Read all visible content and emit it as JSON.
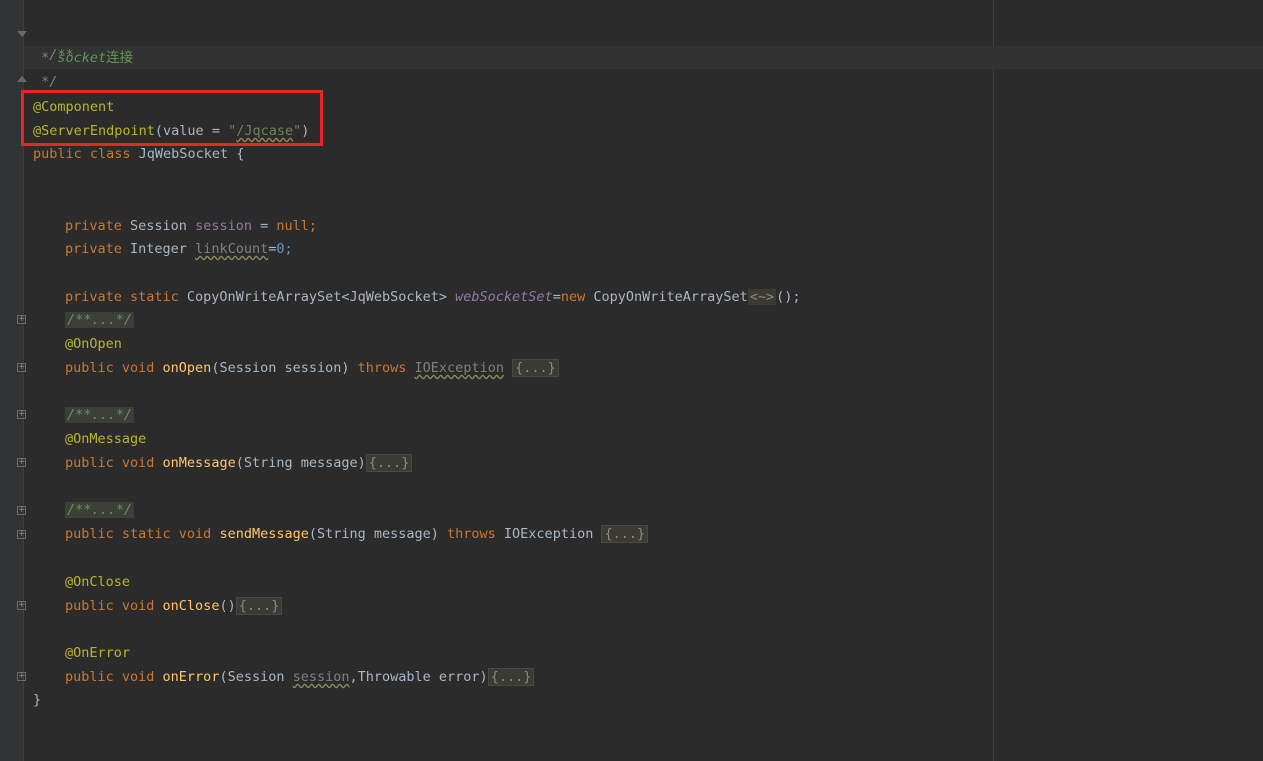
{
  "editor": {
    "lines": {
      "doc_open": "/**",
      "doc_body_star": " * ",
      "doc_body_word": "socket",
      "doc_body_cn": "连接",
      "doc_close": " */",
      "ann_component": "@Component",
      "ann_server": "@ServerEndpoint",
      "server_args_open": "(value = ",
      "server_str_q1": "\"",
      "server_str_path": "/Jqcase",
      "server_str_q2": "\"",
      "server_args_close": ")",
      "class_kw": "public class ",
      "class_name": "JqWebSocket {",
      "f1_kw": "private ",
      "f1_type": "Session ",
      "f1_name": "session",
      "f1_eq": " = ",
      "f1_val": "null;",
      "f2_kw": "private ",
      "f2_type": "Integer ",
      "f2_name": "linkCount",
      "f2_eq": "=",
      "f2_val": "0;",
      "f3_kw": "private static ",
      "f3_type": "CopyOnWriteArraySet<JqWebSocket> ",
      "f3_name": "webSocketSet",
      "f3_eq": "=",
      "f3_new": "new ",
      "f3_ctor": "CopyOnWriteArraySet",
      "f3_diamond": "<~>",
      "f3_end": "();",
      "fold_doc": "/**...*/",
      "ann_onopen": "@OnOpen",
      "m1_kw": "public void ",
      "m1_name": "onOpen",
      "m1_params": "(Session session) ",
      "m1_throws": "throws ",
      "m1_ex": "IOException",
      "fold_body": "{...}",
      "ann_onmessage": "@OnMessage",
      "m2_kw": "public void ",
      "m2_name": "onMessage",
      "m2_params": "(String message)",
      "m3_kw": "public static void ",
      "m3_name": "sendMessage",
      "m3_params": "(String message) ",
      "m3_throws": "throws ",
      "m3_ex": "IOException ",
      "ann_onclose": "@OnClose",
      "m4_kw": "public void ",
      "m4_name": "onClose",
      "m4_params": "()",
      "ann_onerror": "@OnError",
      "m5_kw": "public void ",
      "m5_name": "onError",
      "m5_p1": "(Session ",
      "m5_p2": "session",
      "m5_p3": ",Throwable error)",
      "class_close": "}"
    }
  }
}
